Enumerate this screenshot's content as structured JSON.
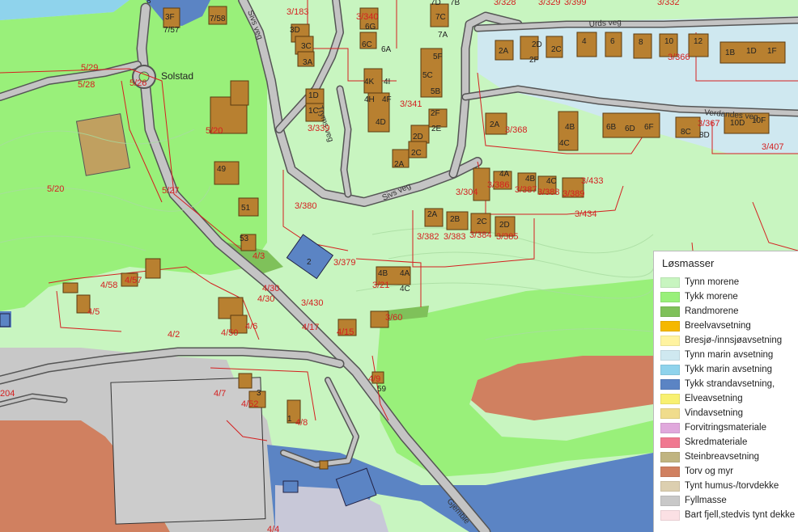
{
  "place_names": {
    "solstad": "Solstad"
  },
  "road_names": {
    "sivs_veg_n": "Sivs veg",
    "sivs_veg_s": "Sivs veg",
    "tryms_veg": "Tryms veg",
    "urds_veg": "Urds veg",
    "verdandes_veg": "Verdandes veg",
    "gjemble": "Gjemble"
  },
  "plots": [
    "5/29",
    "5/28",
    "5/26",
    "5/20",
    "5/20",
    "5/27",
    "3/183",
    "3/340",
    "3/341",
    "3/339",
    "3/328",
    "3/329",
    "3/399",
    "3/332",
    "3/366",
    "3/368",
    "3/367",
    "3/407",
    "3/380",
    "3/304",
    "3/386",
    "3/387",
    "3/388",
    "3/389",
    "3/433",
    "3/434",
    "3/382",
    "3/383",
    "3/384",
    "3/385",
    "3/379",
    "3/21",
    "3/430",
    "3/60",
    "4/3",
    "4/58",
    "4/57",
    "4/5",
    "4/2",
    "4/30",
    "4/30",
    "4/50",
    "4/6",
    "4/17",
    "4/15",
    "4/9",
    "4/7",
    "4/52",
    "4/8",
    "204",
    "4/4"
  ],
  "houses": [
    "3F",
    "7/57",
    "7/58",
    "8",
    "3D",
    "3C",
    "3A",
    "6G",
    "6C",
    "6A",
    "7C",
    "7A",
    "7D",
    "7B",
    "1D",
    "1C",
    "4K",
    "4I",
    "4H",
    "4F",
    "4D",
    "5F",
    "5C",
    "5B",
    "2F",
    "2E",
    "2D",
    "2C",
    "2A",
    "2A",
    "2D",
    "2F",
    "2C",
    "4",
    "6",
    "8",
    "10",
    "12",
    "1B",
    "1D",
    "1F",
    "2A",
    "4B",
    "4C",
    "6B",
    "6D",
    "6F",
    "8C",
    "8D",
    "10D",
    "10F",
    "4A",
    "4B",
    "4C",
    "2A",
    "2B",
    "2C",
    "2D",
    "2",
    "4B",
    "4A",
    "4C",
    "49",
    "51",
    "53",
    "3",
    "59",
    "1"
  ],
  "legend": {
    "title": "Løsmasser",
    "items": [
      {
        "label": "Tynn morene",
        "color": "#c8f5c0"
      },
      {
        "label": "Tykk morene",
        "color": "#99f07a"
      },
      {
        "label": "Randmorene",
        "color": "#7fc15a"
      },
      {
        "label": "Breelvavsetning",
        "color": "#f5b800"
      },
      {
        "label": "Bresjø-/innsjøavsetning",
        "color": "#fff3a0"
      },
      {
        "label": "Tynn marin avsetning",
        "color": "#cfe8f0"
      },
      {
        "label": "Tykk marin avsetning",
        "color": "#8fd3ec"
      },
      {
        "label": "Tykk strandavsetning,",
        "color": "#5b84c4"
      },
      {
        "label": "Elveavsetning",
        "color": "#f8f070"
      },
      {
        "label": "Vindavsetning",
        "color": "#f0dc8c"
      },
      {
        "label": "Forvitringsmateriale",
        "color": "#e0a8dc"
      },
      {
        "label": "Skredmateriale",
        "color": "#f07890"
      },
      {
        "label": "Steinbreavsetning",
        "color": "#c0b480"
      },
      {
        "label": "Torv og myr",
        "color": "#d08060"
      },
      {
        "label": "Tynt humus-/torvdekke",
        "color": "#dccfb0"
      },
      {
        "label": "Fyllmasse",
        "color": "#c8c8c8"
      },
      {
        "label": "Bart fjell,stedvis tynt dekke",
        "color": "#fbe0e4"
      }
    ]
  }
}
